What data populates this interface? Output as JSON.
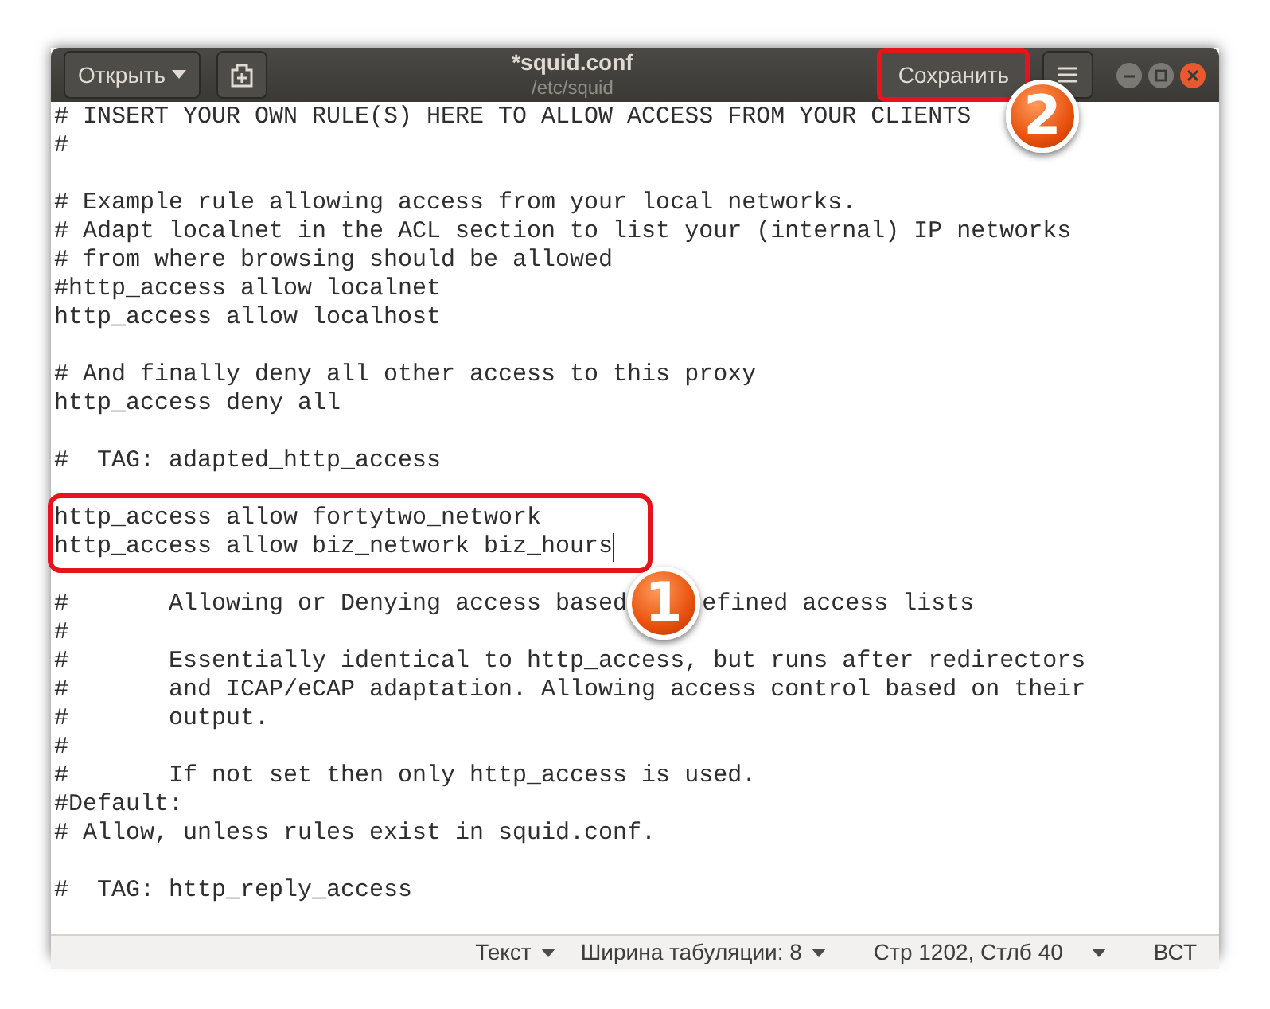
{
  "header": {
    "open_button": "Открыть",
    "title": "*squid.conf",
    "subtitle": "/etc/squid",
    "save_button": "Сохранить",
    "save_highlighted": true,
    "save_callout": "2"
  },
  "blocks": [
    {
      "lines": [
        {
          "text": "# INSERT YOUR OWN RULE(S) HERE TO ALLOW ACCESS FROM YOUR CLIENTS"
        },
        {
          "text": "#"
        }
      ]
    },
    {
      "lines": [
        {
          "text": "# Example rule allowing access from your local networks."
        },
        {
          "text": "# Adapt localnet in the ACL section to list your (internal) IP networks"
        },
        {
          "text": "# from where browsing should be allowed"
        },
        {
          "text": "#http_access allow localnet"
        },
        {
          "text": "http_access allow localhost"
        }
      ]
    },
    {
      "lines": [
        {
          "text": "# And finally deny all other access to this proxy"
        },
        {
          "text": "http_access deny all"
        }
      ]
    },
    {
      "lines": [
        {
          "text": "#  TAG: adapted_http_access"
        }
      ]
    },
    {
      "highlighted": true,
      "lines": [
        {
          "text": "http_access allow fortytwo_network"
        },
        {
          "text": "http_access allow biz_network biz_hours",
          "cursor": true
        }
      ]
    },
    {
      "lines": [
        {
          "text": "#       Allowing or Denying access based",
          "after": "efined access lists",
          "callout": "1"
        },
        {
          "text": "#"
        },
        {
          "text": "#       Essentially identical to http_access, but runs after redirectors"
        },
        {
          "text": "#       and ICAP/eCAP adaptation. Allowing access control based on their"
        },
        {
          "text": "#       output."
        },
        {
          "text": "#"
        },
        {
          "text": "#       If not set then only http_access is used."
        },
        {
          "text": "#Default:"
        },
        {
          "text": "# Allow, unless rules exist in squid.conf."
        }
      ]
    },
    {
      "lines": [
        {
          "text": "#  TAG: http_reply_access"
        }
      ]
    }
  ],
  "status_bar": {
    "syntax": "Текст",
    "tab_width": "Ширина табуляции: 8",
    "position": "Стр 1202, Стлб 40",
    "mode": "ВСТ"
  }
}
